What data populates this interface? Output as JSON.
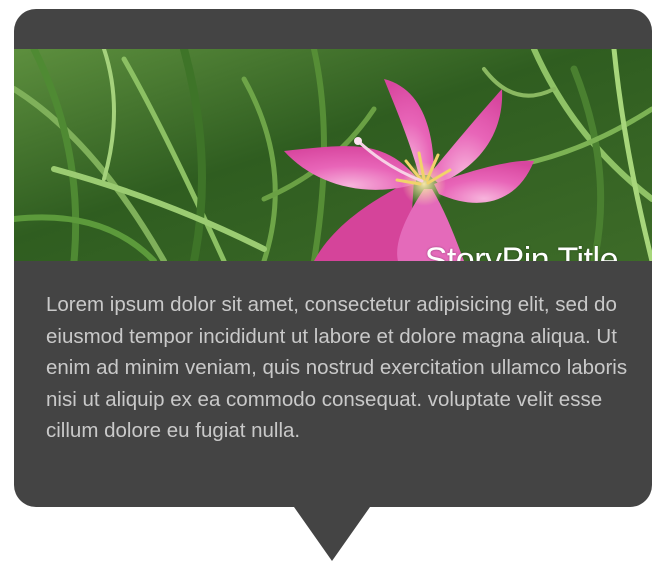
{
  "storypin": {
    "title": "StoryPin Title",
    "description": "Lorem ipsum dolor sit amet, consectetur adipisicing elit, sed do eiusmod tempor incididunt ut labore et dolore magna aliqua. Ut enim ad minim veniam, quis nostrud exercitation ullamco laboris nisi ut aliquip ex ea commodo consequat. voluptate velit esse cillum dolore eu fugiat nulla.",
    "image": "pink-lily-flower-in-grass"
  },
  "colors": {
    "card_background": "#444444",
    "title_text": "#ffffff",
    "body_text": "#c9c9c9",
    "flower_pink": "#e65bb4",
    "grass_green": "#3f7a2a"
  }
}
